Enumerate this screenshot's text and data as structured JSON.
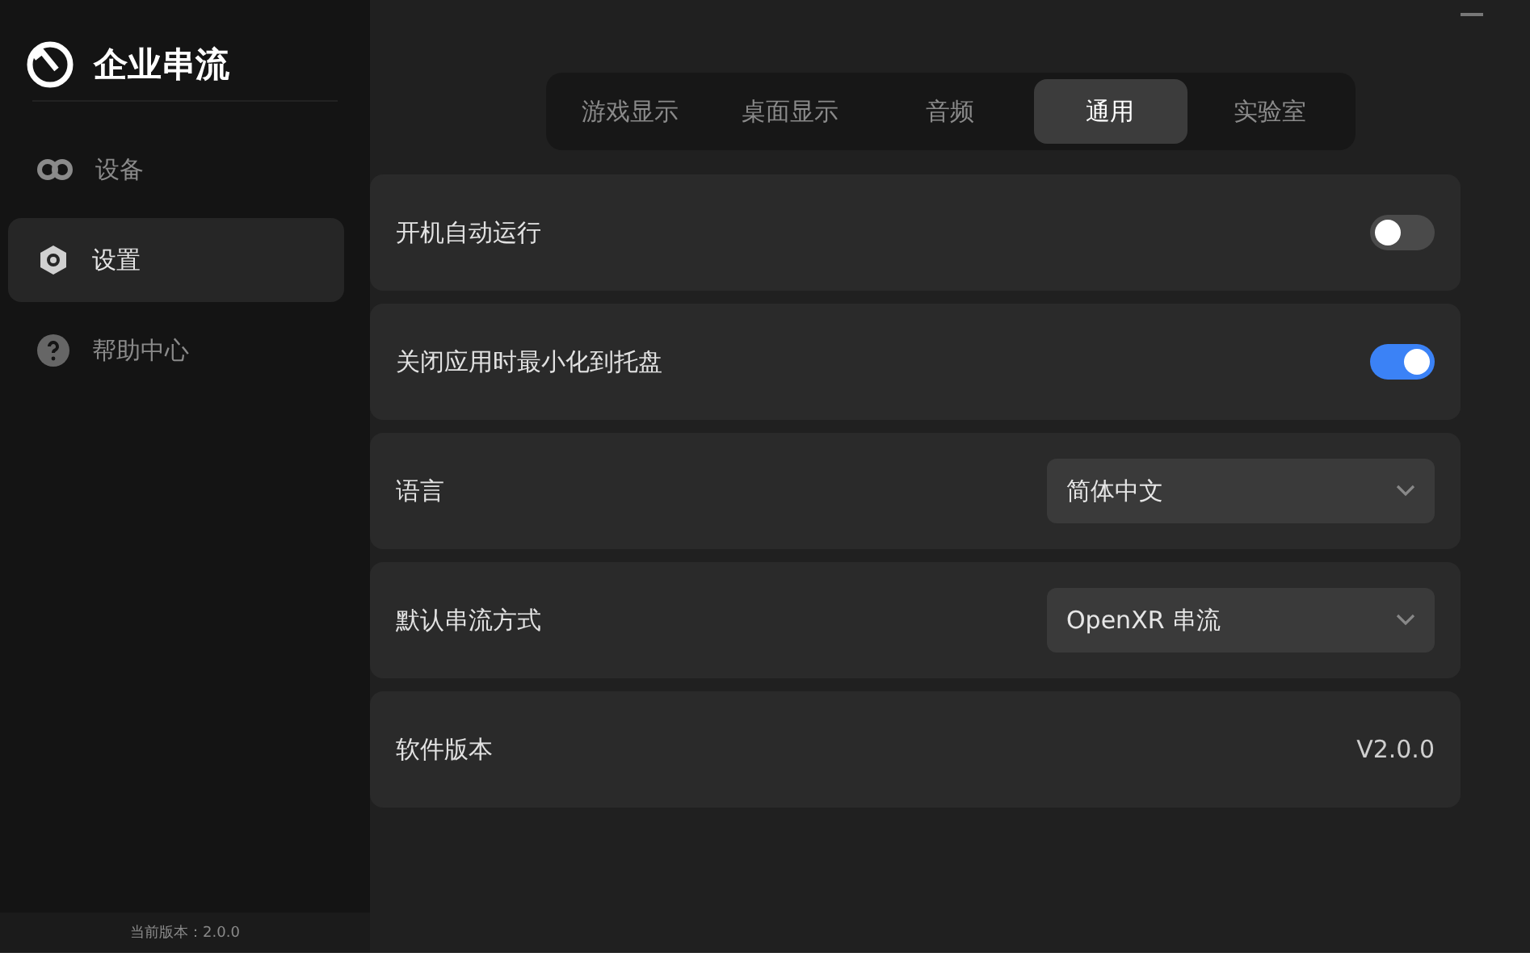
{
  "app": {
    "title": "企业串流"
  },
  "sidebar": {
    "items": [
      {
        "label": "设备",
        "kind": "devices",
        "selected": false
      },
      {
        "label": "设置",
        "kind": "settings",
        "selected": true
      },
      {
        "label": "帮助中心",
        "kind": "help",
        "selected": false
      }
    ],
    "version": "当前版本：2.0.0"
  },
  "tabs": [
    {
      "label": "游戏显示",
      "selected": false
    },
    {
      "label": "桌面显示",
      "selected": false
    },
    {
      "label": "音频",
      "selected": false
    },
    {
      "label": "通用",
      "selected": true
    },
    {
      "label": "实验室",
      "selected": false
    }
  ],
  "settings": [
    {
      "kind": "toggle",
      "label": "开机自动运行",
      "on": false
    },
    {
      "kind": "toggle",
      "label": "关闭应用时最小化到托盘",
      "on": true
    },
    {
      "kind": "select",
      "label": "语言",
      "value": "简体中文"
    },
    {
      "kind": "select",
      "label": "默认串流方式",
      "value": "OpenXR 串流"
    },
    {
      "kind": "text",
      "label": "软件版本",
      "value": "V2.0.0"
    }
  ]
}
